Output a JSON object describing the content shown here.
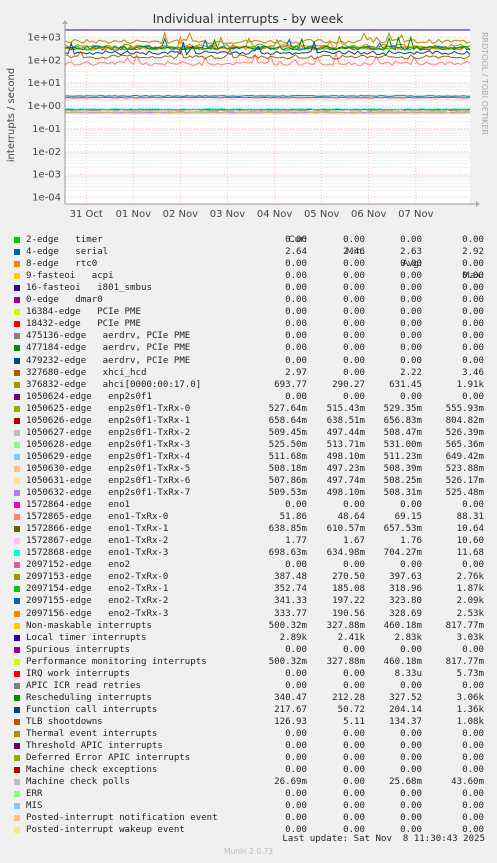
{
  "chart_data": {
    "type": "line",
    "title": "Individual interrupts - by week",
    "ylabel": "interrupts / second",
    "side_label": "RRDTOOL / TOBI OETIKER",
    "y_scale": "log",
    "ylim": [
      5e-05,
      2000
    ],
    "y_ticks": [
      {
        "value": 1000,
        "label": "1e+03"
      },
      {
        "value": 100,
        "label": "1e+02"
      },
      {
        "value": 10,
        "label": "1e+01"
      },
      {
        "value": 1,
        "label": "1e+00"
      },
      {
        "value": 0.1,
        "label": "1e-01"
      },
      {
        "value": 0.01,
        "label": "1e-02"
      },
      {
        "value": 0.001,
        "label": "1e-03"
      },
      {
        "value": 0.0001,
        "label": "1e-04"
      }
    ],
    "x_ticks": [
      "31 Oct",
      "01 Nov",
      "02 Nov",
      "03 Nov",
      "04 Nov",
      "05 Nov",
      "06 Nov",
      "07 Nov"
    ],
    "grid": true,
    "columns": [
      "Cur:",
      "Min:",
      "Avg:",
      "Max:"
    ],
    "series": [
      {
        "name": "2-edge",
        "detail": "timer",
        "color": "#00cc00",
        "cur": "0.00",
        "min": "0.00",
        "avg": "0.00",
        "max": "0.00",
        "level": null
      },
      {
        "name": "4-edge",
        "detail": "serial",
        "color": "#0066b3",
        "cur": "2.64",
        "min": "2.46",
        "avg": "2.63",
        "max": "2.92",
        "level": 2.63
      },
      {
        "name": "8-edge",
        "detail": "rtc0",
        "color": "#ff8000",
        "cur": "0.00",
        "min": "0.00",
        "avg": "0.00",
        "max": "0.00",
        "level": null
      },
      {
        "name": "9-fasteoi",
        "detail": "acpi",
        "color": "#ffcc00",
        "cur": "0.00",
        "min": "0.00",
        "avg": "0.00",
        "max": "0.00",
        "level": null
      },
      {
        "name": "16-fasteoi",
        "detail": "i801_smbus",
        "color": "#330099",
        "cur": "0.00",
        "min": "0.00",
        "avg": "0.00",
        "max": "0.00",
        "level": null
      },
      {
        "name": "0-edge",
        "detail": "dmar0",
        "color": "#990099",
        "cur": "0.00",
        "min": "0.00",
        "avg": "0.00",
        "max": "0.00",
        "level": null
      },
      {
        "name": "16384-edge",
        "detail": "PCIe PME",
        "color": "#ccff00",
        "cur": "0.00",
        "min": "0.00",
        "avg": "0.00",
        "max": "0.00",
        "level": null
      },
      {
        "name": "18432-edge",
        "detail": "PCIe PME",
        "color": "#ff0000",
        "cur": "0.00",
        "min": "0.00",
        "avg": "0.00",
        "max": "0.00",
        "level": null
      },
      {
        "name": "475136-edge",
        "detail": "aerdrv, PCIe PME",
        "color": "#808080",
        "cur": "0.00",
        "min": "0.00",
        "avg": "0.00",
        "max": "0.00",
        "level": null
      },
      {
        "name": "477184-edge",
        "detail": "aerdrv, PCIe PME",
        "color": "#008f00",
        "cur": "0.00",
        "min": "0.00",
        "avg": "0.00",
        "max": "0.00",
        "level": null
      },
      {
        "name": "479232-edge",
        "detail": "aerdrv, PCIe PME",
        "color": "#00487d",
        "cur": "0.00",
        "min": "0.00",
        "avg": "0.00",
        "max": "0.00",
        "level": null
      },
      {
        "name": "327680-edge",
        "detail": "xhci_hcd",
        "color": "#b35a00",
        "cur": "2.97",
        "min": "0.00",
        "avg": "2.22",
        "max": "3.46",
        "level": 2.22
      },
      {
        "name": "376832-edge",
        "detail": "ahci[0000:00:17.0]",
        "color": "#b38f00",
        "cur": "693.77",
        "min": "290.27",
        "avg": "631.45",
        "max": "1.91k",
        "level": 631.45
      },
      {
        "name": "1050624-edge",
        "detail": "enp2s0f1",
        "color": "#6b006b",
        "cur": "0.00",
        "min": "0.00",
        "avg": "0.00",
        "max": "0.00",
        "level": null
      },
      {
        "name": "1050625-edge",
        "detail": "enp2s0f1-TxRx-0",
        "color": "#8fb300",
        "cur": "527.64m",
        "min": "515.43m",
        "avg": "529.35m",
        "max": "555.93m",
        "level": 0.529
      },
      {
        "name": "1050626-edge",
        "detail": "enp2s0f1-TxRx-1",
        "color": "#b30000",
        "cur": "658.64m",
        "min": "638.51m",
        "avg": "656.83m",
        "max": "804.82m",
        "level": 0.657
      },
      {
        "name": "1050627-edge",
        "detail": "enp2s0f1-TxRx-2",
        "color": "#bebebe",
        "cur": "509.45m",
        "min": "497.44m",
        "avg": "508.47m",
        "max": "526.39m",
        "level": 0.508
      },
      {
        "name": "1050628-edge",
        "detail": "enp2s0f1-TxRx-3",
        "color": "#80ff80",
        "cur": "525.50m",
        "min": "513.71m",
        "avg": "531.00m",
        "max": "565.36m",
        "level": 0.531
      },
      {
        "name": "1050629-edge",
        "detail": "enp2s0f1-TxRx-4",
        "color": "#80c9ff",
        "cur": "511.68m",
        "min": "498.10m",
        "avg": "511.23m",
        "max": "649.42m",
        "level": 0.511
      },
      {
        "name": "1050630-edge",
        "detail": "enp2s0f1-TxRx-5",
        "color": "#ffc080",
        "cur": "508.18m",
        "min": "497.23m",
        "avg": "508.39m",
        "max": "523.88m",
        "level": 0.508
      },
      {
        "name": "1050631-edge",
        "detail": "enp2s0f1-TxRx-6",
        "color": "#ffe680",
        "cur": "507.86m",
        "min": "497.74m",
        "avg": "508.25m",
        "max": "526.17m",
        "level": 0.508
      },
      {
        "name": "1050632-edge",
        "detail": "enp2s0f1-TxRx-7",
        "color": "#aa80ff",
        "cur": "509.53m",
        "min": "498.10m",
        "avg": "508.31m",
        "max": "525.48m",
        "level": 0.508
      },
      {
        "name": "1572864-edge",
        "detail": "eno1",
        "color": "#ee00cc",
        "cur": "0.00",
        "min": "0.00",
        "avg": "0.00",
        "max": "0.00",
        "level": null
      },
      {
        "name": "1572865-edge",
        "detail": "eno1-TxRx-0",
        "color": "#ff8080",
        "cur": "51.86",
        "min": "48.64",
        "avg": "69.15",
        "max": "88.31",
        "level": 69.15
      },
      {
        "name": "1572866-edge",
        "detail": "eno1-TxRx-1",
        "color": "#666600",
        "cur": "638.85m",
        "min": "610.57m",
        "avg": "657.53m",
        "max": "10.64",
        "level": 0.658
      },
      {
        "name": "1572867-edge",
        "detail": "eno1-TxRx-2",
        "color": "#ffbfff",
        "cur": "1.77",
        "min": "1.67",
        "avg": "1.76",
        "max": "10.60",
        "level": 1.76
      },
      {
        "name": "1572868-edge",
        "detail": "eno1-TxRx-3",
        "color": "#00ffcc",
        "cur": "698.63m",
        "min": "634.98m",
        "avg": "704.27m",
        "max": "11.68",
        "level": 0.704
      },
      {
        "name": "2097152-edge",
        "detail": "eno2",
        "color": "#cc6699",
        "cur": "0.00",
        "min": "0.00",
        "avg": "0.00",
        "max": "0.00",
        "level": null
      },
      {
        "name": "2097153-edge",
        "detail": "eno2-TxRx-0",
        "color": "#999900",
        "cur": "387.48",
        "min": "270.50",
        "avg": "397.63",
        "max": "2.76k",
        "level": 397.63
      },
      {
        "name": "2097154-edge",
        "detail": "eno2-TxRx-1",
        "color": "#00cc00",
        "cur": "352.74",
        "min": "185.08",
        "avg": "318.96",
        "max": "1.87k",
        "level": 318.96
      },
      {
        "name": "2097155-edge",
        "detail": "eno2-TxRx-2",
        "color": "#0066b3",
        "cur": "341.33",
        "min": "197.22",
        "avg": "323.80",
        "max": "2.09k",
        "level": 323.8
      },
      {
        "name": "2097156-edge",
        "detail": "eno2-TxRx-3",
        "color": "#ff8000",
        "cur": "333.77",
        "min": "190.56",
        "avg": "328.69",
        "max": "2.53k",
        "level": 328.69
      },
      {
        "name": "Non-maskable interrupts",
        "detail": "",
        "color": "#ffcc00",
        "cur": "500.32m",
        "min": "327.88m",
        "avg": "460.18m",
        "max": "817.77m",
        "level": 0.46
      },
      {
        "name": "Local timer interrupts",
        "detail": "",
        "color": "#330099",
        "cur": "2.89k",
        "min": "2.41k",
        "avg": "2.83k",
        "max": "3.03k",
        "level": 2830
      },
      {
        "name": "Spurious interrupts",
        "detail": "",
        "color": "#990099",
        "cur": "0.00",
        "min": "0.00",
        "avg": "0.00",
        "max": "0.00",
        "level": null
      },
      {
        "name": "Performance monitoring interrupts",
        "detail": "",
        "color": "#ccff00",
        "cur": "500.32m",
        "min": "327.88m",
        "avg": "460.18m",
        "max": "817.77m",
        "level": 0.46
      },
      {
        "name": "IRQ work interrupts",
        "detail": "",
        "color": "#ff0000",
        "cur": "0.00",
        "min": "0.00",
        "avg": "8.33u",
        "max": "5.73m",
        "level": null
      },
      {
        "name": "APIC ICR read retries",
        "detail": "",
        "color": "#808080",
        "cur": "0.00",
        "min": "0.00",
        "avg": "0.00",
        "max": "0.00",
        "level": null
      },
      {
        "name": "Rescheduling interrupts",
        "detail": "",
        "color": "#008f00",
        "cur": "340.47",
        "min": "212.28",
        "avg": "327.52",
        "max": "3.06k",
        "level": 327.52
      },
      {
        "name": "Function call interrupts",
        "detail": "",
        "color": "#00487d",
        "cur": "217.67",
        "min": "50.72",
        "avg": "204.14",
        "max": "1.36k",
        "level": 204.14
      },
      {
        "name": "TLB shootdowns",
        "detail": "",
        "color": "#b35a00",
        "cur": "126.93",
        "min": "5.11",
        "avg": "134.37",
        "max": "1.08k",
        "level": 134.37
      },
      {
        "name": "Thermal event interrupts",
        "detail": "",
        "color": "#b38f00",
        "cur": "0.00",
        "min": "0.00",
        "avg": "0.00",
        "max": "0.00",
        "level": null
      },
      {
        "name": "Threshold APIC interrupts",
        "detail": "",
        "color": "#6b006b",
        "cur": "0.00",
        "min": "0.00",
        "avg": "0.00",
        "max": "0.00",
        "level": null
      },
      {
        "name": "Deferred Error APIC interrupts",
        "detail": "",
        "color": "#8fb300",
        "cur": "0.00",
        "min": "0.00",
        "avg": "0.00",
        "max": "0.00",
        "level": null
      },
      {
        "name": "Machine check exceptions",
        "detail": "",
        "color": "#b30000",
        "cur": "0.00",
        "min": "0.00",
        "avg": "0.00",
        "max": "0.00",
        "level": null
      },
      {
        "name": "Machine check polls",
        "detail": "",
        "color": "#bebebe",
        "cur": "26.69m",
        "min": "0.00",
        "avg": "25.68m",
        "max": "43.60m",
        "level": null
      },
      {
        "name": "ERR",
        "detail": "",
        "color": "#80ff80",
        "cur": "0.00",
        "min": "0.00",
        "avg": "0.00",
        "max": "0.00",
        "level": null
      },
      {
        "name": "MIS",
        "detail": "",
        "color": "#80c9ff",
        "cur": "0.00",
        "min": "0.00",
        "avg": "0.00",
        "max": "0.00",
        "level": null
      },
      {
        "name": "Posted-interrupt notification event",
        "detail": "",
        "color": "#ffc080",
        "cur": "0.00",
        "min": "0.00",
        "avg": "0.00",
        "max": "0.00",
        "level": null
      },
      {
        "name": "Posted-interrupt wakeup event",
        "detail": "",
        "color": "#ffe680",
        "cur": "0.00",
        "min": "0.00",
        "avg": "0.00",
        "max": "0.00",
        "level": null
      }
    ]
  },
  "last_update": "Last update: Sat Nov  8 11:30:43 2025",
  "footer": "Munin 2.0.73"
}
